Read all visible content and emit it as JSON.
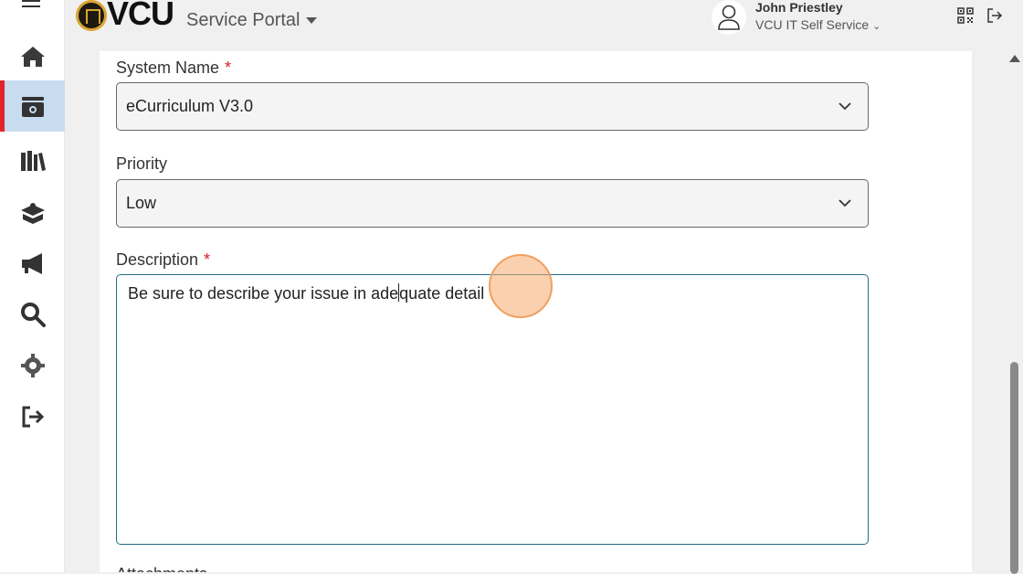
{
  "header": {
    "logo_text": "VCU",
    "portal_title": "Service Portal",
    "user_name": "John Priestley",
    "user_org": "VCU IT Self Service"
  },
  "rail": {
    "items": [
      {
        "name": "home",
        "icon": "home-icon"
      },
      {
        "name": "tickets",
        "icon": "inbox-icon",
        "active": true
      },
      {
        "name": "knowledge",
        "icon": "library-icon"
      },
      {
        "name": "services",
        "icon": "service-box-icon"
      },
      {
        "name": "announcements",
        "icon": "megaphone-icon"
      },
      {
        "name": "search",
        "icon": "search-icon"
      },
      {
        "name": "settings",
        "icon": "gear-icon"
      },
      {
        "name": "logout",
        "icon": "sign-out-icon"
      }
    ]
  },
  "form": {
    "system_name": {
      "label": "System Name",
      "required_mark": "*",
      "value": "eCurriculum V3.0"
    },
    "priority": {
      "label": "Priority",
      "value": "Low"
    },
    "description": {
      "label": "Description",
      "required_mark": "*",
      "value_before_cursor": "Be sure to describe your issue in ade",
      "value_after_cursor": "quate detail"
    },
    "next_label": "Attachments"
  },
  "colors": {
    "accent_active": "#c8dcef",
    "active_marker": "#e0242e",
    "required": "#d0202a",
    "textarea_border": "#1f6f85",
    "click_indicator": "#f8aa6e"
  }
}
